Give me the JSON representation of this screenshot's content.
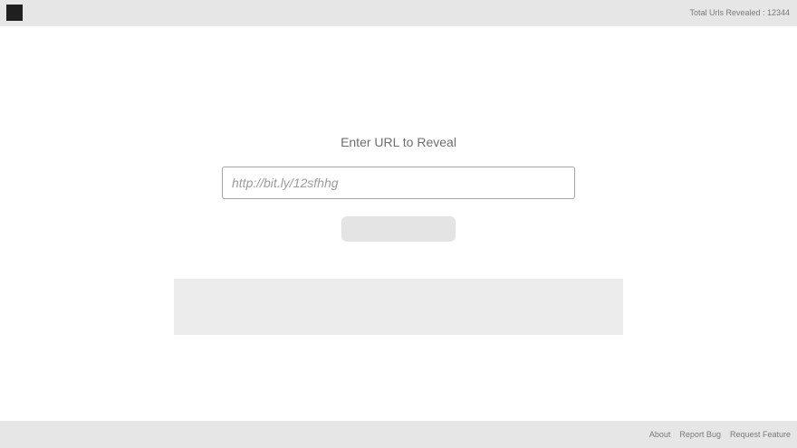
{
  "header": {
    "logo_icon": "square-logo-icon",
    "counter_text": "Total Urls Revealed : 12344"
  },
  "main": {
    "title": "Enter URL to Reveal",
    "url_input": {
      "value": "",
      "placeholder": "http://bit.ly/12sfhhg"
    },
    "reveal_button_label": "",
    "result_text": ""
  },
  "footer": {
    "links": [
      "About",
      "Report Bug",
      "Request Feature"
    ]
  },
  "colors": {
    "bar_background": "#e6e6e6",
    "logo": "#1f1f1f",
    "button_background": "#e4e4e4",
    "result_panel_background": "#ececec"
  }
}
